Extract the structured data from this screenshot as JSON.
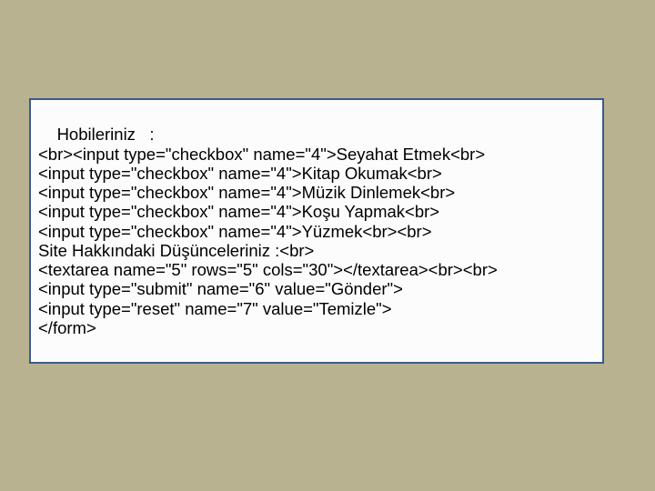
{
  "lines": [
    "Hobileriniz   :",
    "<br><input type=\"checkbox\" name=\"4\">Seyahat Etmek<br>",
    "<input type=\"checkbox\" name=\"4\">Kitap Okumak<br>",
    "<input type=\"checkbox\" name=\"4\">Müzik Dinlemek<br>",
    "<input type=\"checkbox\" name=\"4\">Koşu Yapmak<br>",
    "<input type=\"checkbox\" name=\"4\">Yüzmek<br><br>",
    "Site Hakkındaki Düşünceleriniz :<br>",
    "<textarea name=\"5\" rows=\"5\" cols=\"30\"></textarea><br><br>",
    "<input type=\"submit\" name=\"6\" value=\"Gönder\">",
    "<input type=\"reset\" name=\"7\" value=\"Temizle\">",
    "</form>"
  ]
}
